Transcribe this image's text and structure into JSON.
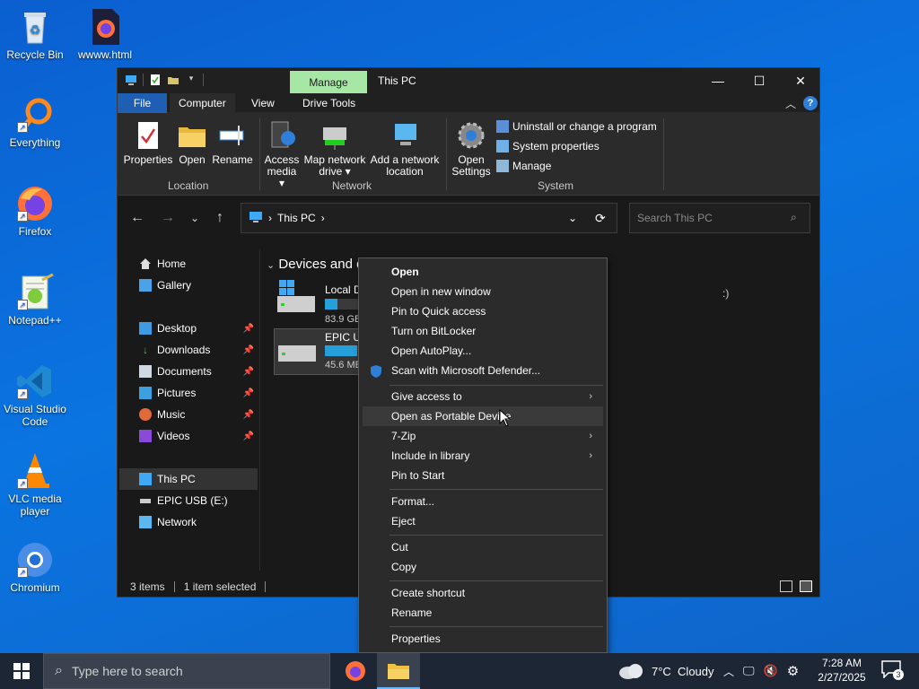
{
  "desktop": {
    "icons": [
      {
        "label": "Recycle Bin"
      },
      {
        "label": "wwww.html"
      },
      {
        "label": "Everything"
      },
      {
        "label": "Firefox"
      },
      {
        "label": "Notepad++"
      },
      {
        "label": "Visual Studio Code"
      },
      {
        "label": "VLC media player"
      },
      {
        "label": "Chromium"
      }
    ]
  },
  "window": {
    "title": "This PC",
    "manage_tab": "Manage",
    "tabs": {
      "file": "File",
      "computer": "Computer",
      "view": "View",
      "drive_tools": "Drive Tools"
    },
    "ribbon": {
      "location": {
        "label": "Location",
        "properties": "Properties",
        "open": "Open",
        "rename": "Rename"
      },
      "network": {
        "label": "Network",
        "access_media": "Access media",
        "map_network_drive": "Map network drive",
        "add_network_location": "Add a network location"
      },
      "system": {
        "label": "System",
        "open_settings": "Open Settings",
        "uninstall": "Uninstall or change a program",
        "system_properties": "System properties",
        "manage": "Manage"
      }
    },
    "address": {
      "path": "This PC",
      "separator": "›"
    },
    "search_placeholder": "Search This PC",
    "sidebar": {
      "home": "Home",
      "gallery": "Gallery",
      "desktop": "Desktop",
      "downloads": "Downloads",
      "documents": "Documents",
      "pictures": "Pictures",
      "music": "Music",
      "videos": "Videos",
      "this_pc": "This PC",
      "usb": "EPIC USB (E:)",
      "network": "Network"
    },
    "content": {
      "section_title": "Devices and d",
      "drives": [
        {
          "name": "Local D",
          "free": "83.9 GB",
          "usage": 0.35,
          "suffix": ":)"
        },
        {
          "name": "EPIC US",
          "free": "45.6 ME",
          "usage": 0.9
        }
      ]
    },
    "status": {
      "items": "3 items",
      "selected": "1 item selected"
    }
  },
  "context_menu": {
    "items": [
      {
        "label": "Open",
        "bold": true
      },
      {
        "label": "Open in new window"
      },
      {
        "label": "Pin to Quick access"
      },
      {
        "label": "Turn on BitLocker"
      },
      {
        "label": "Open AutoPlay..."
      },
      {
        "label": "Scan with Microsoft Defender..."
      },
      {
        "label": "Give access to",
        "submenu": true
      },
      {
        "label": "Open as Portable Device"
      },
      {
        "label": "7-Zip",
        "submenu": true
      },
      {
        "label": "Include in library",
        "submenu": true
      },
      {
        "label": "Pin to Start"
      },
      {
        "label": "Format..."
      },
      {
        "label": "Eject"
      },
      {
        "label": "Cut"
      },
      {
        "label": "Copy"
      },
      {
        "label": "Create shortcut"
      },
      {
        "label": "Rename"
      },
      {
        "label": "Properties"
      }
    ]
  },
  "taskbar": {
    "search_placeholder": "Type here to search",
    "weather": "7°C  Cloudy",
    "time": "7:28 AM",
    "date": "2/27/2025",
    "notifications": "3"
  },
  "colors": {
    "accent": "#1e5fb3",
    "manage_tab": "#a6e7a6",
    "desktop": "#0a74e0"
  }
}
